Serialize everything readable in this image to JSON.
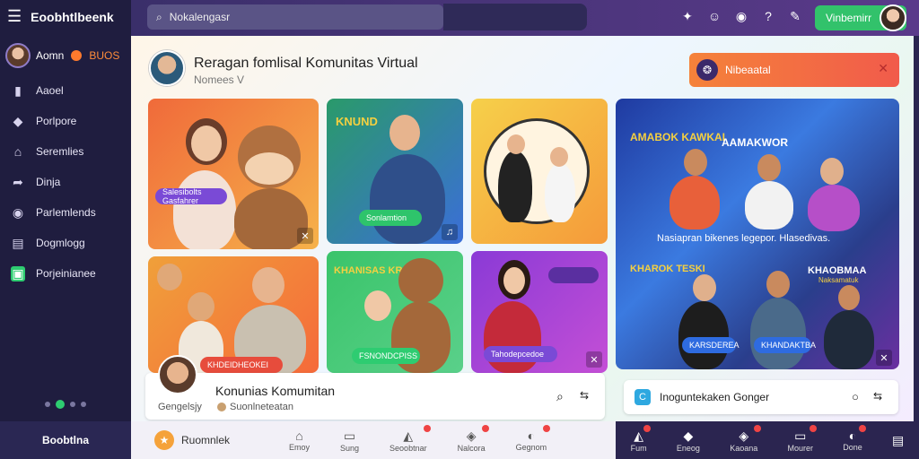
{
  "app": {
    "title": "Eoobhtlbeenk",
    "menu_icon": "menu-icon"
  },
  "profile": {
    "name": "Aomn",
    "badge_text": "BUOS"
  },
  "sidebar": {
    "items": [
      {
        "label": "Aaoel",
        "icon": "bookmark-icon"
      },
      {
        "label": "Porlpore",
        "icon": "diamond-icon"
      },
      {
        "label": "Seremlies",
        "icon": "home-icon"
      },
      {
        "label": "Dinja",
        "icon": "share-icon"
      },
      {
        "label": "Parlemlends",
        "icon": "record-icon"
      },
      {
        "label": "Dogmlogg",
        "icon": "document-icon"
      },
      {
        "label": "Porjeinianee",
        "icon": "chat-icon",
        "active": true
      }
    ],
    "footer": "Boobtlna"
  },
  "topbar": {
    "search_text": "Nokalengasr",
    "cta_label": "Vinbemirr"
  },
  "header": {
    "title": "Reragan fomlisal Komunitas Virtual",
    "subtitle": "Nomees V"
  },
  "notice": {
    "text": "Nibeaatal"
  },
  "cards": [
    {
      "pill": "Salesibolts Gasfahrer",
      "accent": "#7a4ad6"
    },
    {
      "title": "KNUND",
      "pill": "Sonlamtion",
      "accent": "#2ec46b"
    },
    {
      "accent": "#f5b83a"
    },
    {
      "banner": "AMABOK KAWKAI",
      "banner2": "AAMAKWOR",
      "caption": "Nasiapran bikenes legepor. Hlasedivas."
    },
    {
      "pill": "KHDEIDHEOKEI",
      "accent": "#e74c3c"
    },
    {
      "title": "KHANISAS KRASS",
      "pill": "FSNONDCPISS",
      "accent": "#2ecc71"
    },
    {
      "pill": "Tahodepcedoe",
      "accent": "#7a4ad6"
    },
    {
      "left": "KHAROK TESKI",
      "left_pill": "KARSDEREA",
      "right": "KHAOBMAA",
      "right_sub": "Naksamatuk",
      "right_pill": "KHANDAKTBA"
    }
  ],
  "bottom_left": {
    "title": "Konunias Komumitan",
    "meta1": "Gengelsjy",
    "meta2": "Suonlneteatan"
  },
  "bottom_right": {
    "title": "Inoguntekaken Gonger"
  },
  "bottom_nav": {
    "primary": "Ruomnlek",
    "items": [
      "Emoy",
      "Sung",
      "Seoobtnar",
      "Nalcora",
      "Gegnom"
    ]
  },
  "bottom_nav_right": {
    "items": [
      "Fum",
      "Eneog",
      "Kaoana",
      "Mourer",
      "Done"
    ]
  }
}
